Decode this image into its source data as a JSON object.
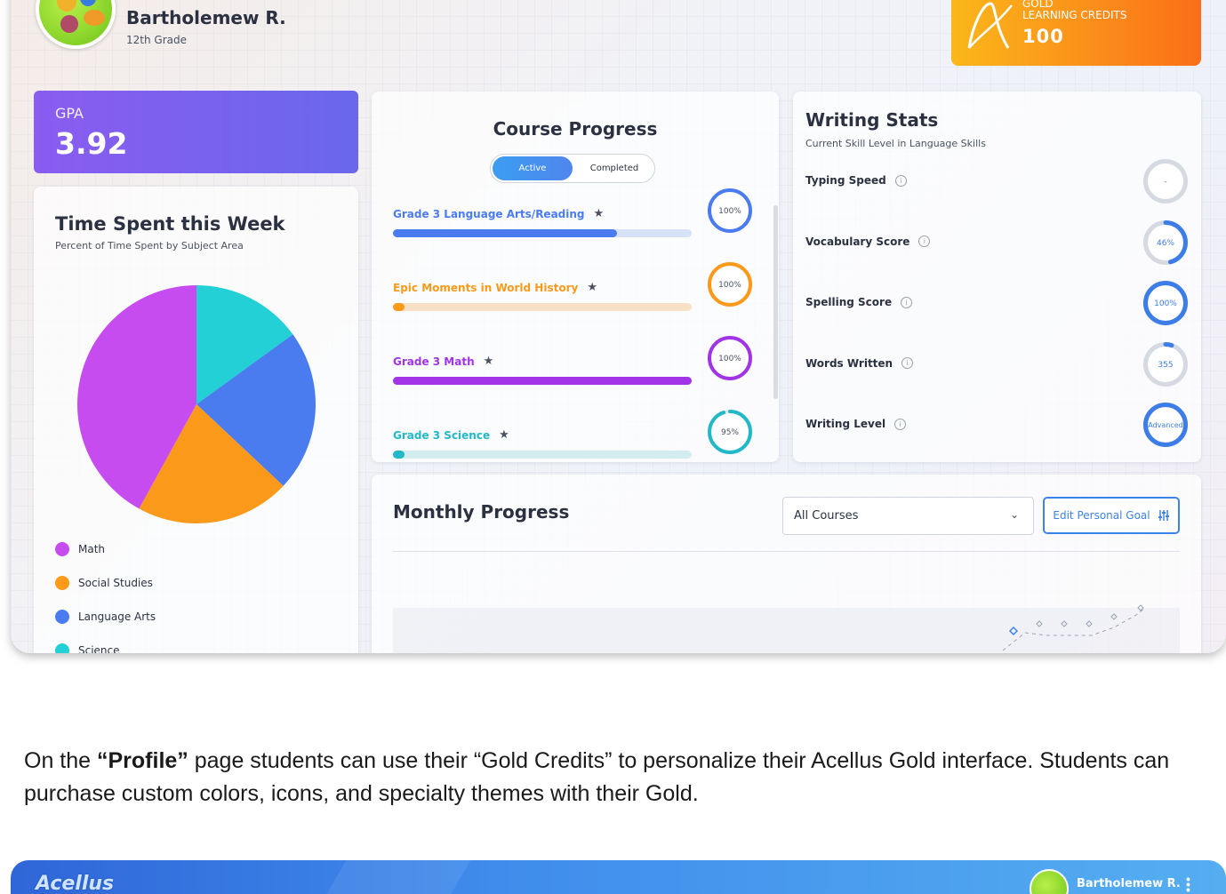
{
  "user": {
    "name": "Bartholemew R.",
    "grade": "12th Grade"
  },
  "gold": {
    "label_top": "GOLD",
    "label": "LEARNING CREDITS",
    "value": "100"
  },
  "gpa": {
    "label": "GPA",
    "value": "3.92"
  },
  "time_spent": {
    "title": "Time Spent this Week",
    "subtitle": "Percent of Time Spent by Subject Area",
    "legend": [
      {
        "label": "Math",
        "color": "#c64cf0"
      },
      {
        "label": "Social Studies",
        "color": "#fb9a1a"
      },
      {
        "label": "Language Arts",
        "color": "#4a7cf0"
      },
      {
        "label": "Science",
        "color": "#22d0d6"
      }
    ]
  },
  "chart_data": {
    "type": "pie",
    "categories": [
      "Math",
      "Social Studies",
      "Language Arts",
      "Science"
    ],
    "values": [
      42,
      21,
      22,
      15
    ],
    "title": "Time Spent this Week",
    "subtitle": "Percent of Time Spent by Subject Area"
  },
  "course_progress": {
    "title": "Course Progress",
    "tabs": {
      "active": "Active",
      "completed": "Completed"
    },
    "courses": [
      {
        "name": "Grade 3 Language Arts/Reading",
        "progress": 75,
        "ring": "100%",
        "ring_value": 100,
        "color": "#4a7cf0",
        "track": "#d6e2f8"
      },
      {
        "name": "Epic Moments in World History",
        "progress": 4,
        "ring": "100%",
        "ring_value": 100,
        "color": "#fb9a1a",
        "track": "#f6e0c6"
      },
      {
        "name": "Grade 3 Math",
        "progress": 100,
        "ring": "100%",
        "ring_value": 100,
        "color": "#a034e6",
        "track": "#ead6f8"
      },
      {
        "name": "Grade 3 Science",
        "progress": 4,
        "ring": "95%",
        "ring_value": 95,
        "color": "#22b8c8",
        "track": "#d2ecf0"
      }
    ]
  },
  "writing_stats": {
    "title": "Writing Stats",
    "subtitle": "Current Skill Level in Language Skills",
    "rows": [
      {
        "label": "Typing Speed",
        "value": "-",
        "fill": 0
      },
      {
        "label": "Vocabulary Score",
        "value": "46%",
        "fill": 46
      },
      {
        "label": "Spelling Score",
        "value": "100%",
        "fill": 100
      },
      {
        "label": "Words Written",
        "value": "355",
        "fill": 5
      },
      {
        "label": "Writing Level",
        "value": "Advanced",
        "fill": 100
      }
    ]
  },
  "monthly_progress": {
    "title": "Monthly Progress",
    "select_value": "All Courses",
    "goal_button": "Edit Personal Goal"
  },
  "caption": {
    "part1": "On the ",
    "bold": "“Profile”",
    "part2": " page students can use their “Gold Credits” to personalize their Acellus Gold interface. Students can purchase custom colors, icons, and specialty themes with their Gold."
  },
  "appbar": {
    "logo": "Acellus",
    "name": "Bartholemew R."
  }
}
